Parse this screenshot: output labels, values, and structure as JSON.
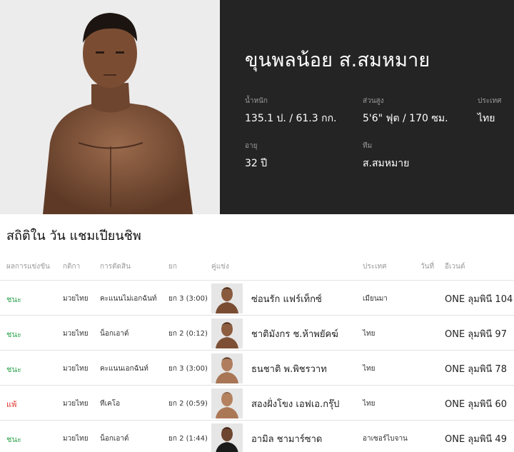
{
  "fighter": {
    "name": "ขุนพลน้อย ส.สมหมาย",
    "stats": {
      "weight_label": "น้ำหนัก",
      "weight_value": "135.1 ป. / 61.3 กก.",
      "height_label": "ส่วนสูง",
      "height_value": "5'6\" ฟุต / 170 ซม.",
      "country_label": "ประเทศ",
      "country_value": "ไทย",
      "age_label": "อายุ",
      "age_value": "32 ปี",
      "team_label": "ทีม",
      "team_value": "ส.สมหมาย"
    }
  },
  "section": {
    "title": "สถิติใน วัน แชมเปียนชิพ"
  },
  "table": {
    "headers": {
      "result": "ผลการแข่งขัน",
      "rules": "กติกา",
      "method": "การตัดสิน",
      "round": "ยก",
      "opponent": "คู่แข่ง",
      "country": "ประเทศ",
      "date": "วันที่",
      "event": "อีเวนต์"
    },
    "rows": [
      {
        "result": "ชนะ",
        "status": "win",
        "rules": "มวยไทย",
        "method": "คะแนนไม่เอกฉันท์",
        "round": "ยก 3 (3:00)",
        "opponent": "ซ่อนรัก แฟร์เท็กซ์",
        "country": "เมียนมา",
        "event": "ONE ลุมพินี 104"
      },
      {
        "result": "ชนะ",
        "status": "win",
        "rules": "มวยไทย",
        "method": "น็อกเอาต์",
        "round": "ยก 2 (0:12)",
        "opponent": "ชาติมังกร ช.ห้าพยัคฆ์",
        "country": "ไทย",
        "event": "ONE ลุมพินี 97"
      },
      {
        "result": "ชนะ",
        "status": "win",
        "rules": "มวยไทย",
        "method": "คะแนนเอกฉันท์",
        "round": "ยก 3 (3:00)",
        "opponent": "ธนชาติ พ.พิชรวาท",
        "country": "ไทย",
        "event": "ONE ลุมพินี 78"
      },
      {
        "result": "แพ้",
        "status": "loss",
        "rules": "มวยไทย",
        "method": "ทีเคโอ",
        "round": "ยก 2 (0:59)",
        "opponent": "สองฝั่งโขง เอฟเอ.กรุ๊ป",
        "country": "ไทย",
        "event": "ONE ลุมพินี 60"
      },
      {
        "result": "ชนะ",
        "status": "win",
        "rules": "มวยไทย",
        "method": "น็อกเอาต์",
        "round": "ยก 2 (1:44)",
        "opponent": "อามิล ชามาร์ซาด",
        "country": "อาเซอร์ไบจาน",
        "event": "ONE ลุมพินี 49"
      }
    ]
  }
}
